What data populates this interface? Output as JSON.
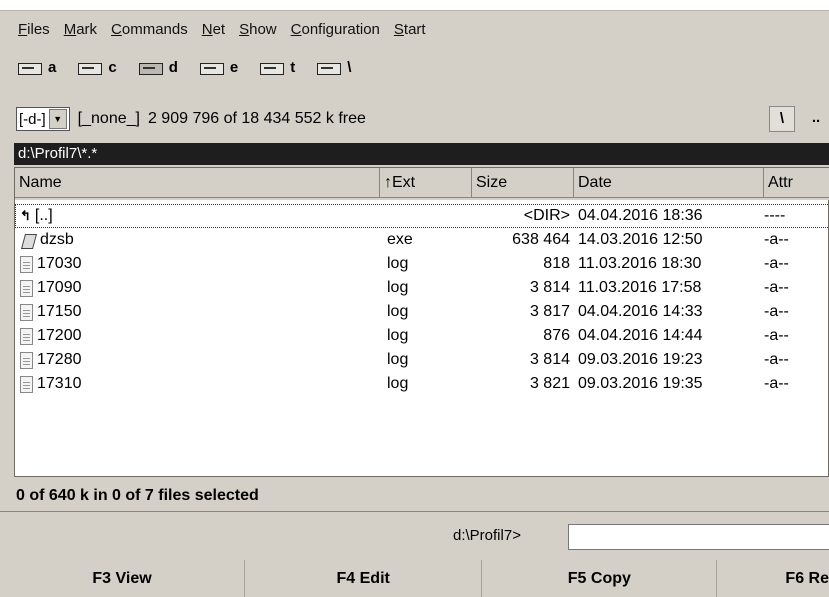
{
  "menu": [
    "Files",
    "Mark",
    "Commands",
    "Net",
    "Show",
    "Configuration",
    "Start"
  ],
  "drives": [
    {
      "letter": "a",
      "icon": "floppy-drive-icon"
    },
    {
      "letter": "c",
      "icon": "hard-drive-icon"
    },
    {
      "letter": "d",
      "icon": "hard-drive-icon",
      "selected": true
    },
    {
      "letter": "e",
      "icon": "hard-drive-icon"
    },
    {
      "letter": "t",
      "icon": "network-drive-icon"
    },
    {
      "letter": "\\",
      "icon": "network-icon"
    }
  ],
  "path_row": {
    "drive_select": "[-d-]",
    "volume_label": "[_none_]",
    "free_space": "2 909 796 of 18 434 552 k free",
    "root_button": "\\",
    "up_button": ".."
  },
  "current_path": "d:\\Profil7\\*.*",
  "columns": {
    "name": "Name",
    "ext": "↑Ext",
    "size": "Size",
    "date": "Date",
    "attr": "Attr"
  },
  "files": [
    {
      "name": "[..]",
      "ext": "",
      "size": "<DIR>",
      "date": "04.04.2016 18:36",
      "attr": "----",
      "icon": "parent-dir-icon"
    },
    {
      "name": "dzsb",
      "ext": "exe",
      "size": "638 464",
      "date": "14.03.2016 12:50",
      "attr": "-a--",
      "icon": "executable-icon"
    },
    {
      "name": "17030",
      "ext": "log",
      "size": "818",
      "date": "11.03.2016 18:30",
      "attr": "-a--",
      "icon": "file-icon"
    },
    {
      "name": "17090",
      "ext": "log",
      "size": "3 814",
      "date": "11.03.2016 17:58",
      "attr": "-a--",
      "icon": "file-icon"
    },
    {
      "name": "17150",
      "ext": "log",
      "size": "3 817",
      "date": "04.04.2016 14:33",
      "attr": "-a--",
      "icon": "file-icon"
    },
    {
      "name": "17200",
      "ext": "log",
      "size": "876",
      "date": "04.04.2016 14:44",
      "attr": "-a--",
      "icon": "file-icon"
    },
    {
      "name": "17280",
      "ext": "log",
      "size": "3 814",
      "date": "09.03.2016 19:23",
      "attr": "-a--",
      "icon": "file-icon"
    },
    {
      "name": "17310",
      "ext": "log",
      "size": "3 821",
      "date": "09.03.2016 19:35",
      "attr": "-a--",
      "icon": "file-icon"
    }
  ],
  "status": "0 of 640 k in 0 of 7 files selected",
  "command_prompt": "d:\\Profil7>",
  "function_keys": [
    "F3 View",
    "F4 Edit",
    "F5 Copy",
    "F6 Re"
  ],
  "colors": {
    "path_bar": "#1e1e1e",
    "chrome": "#d4d0c8"
  }
}
